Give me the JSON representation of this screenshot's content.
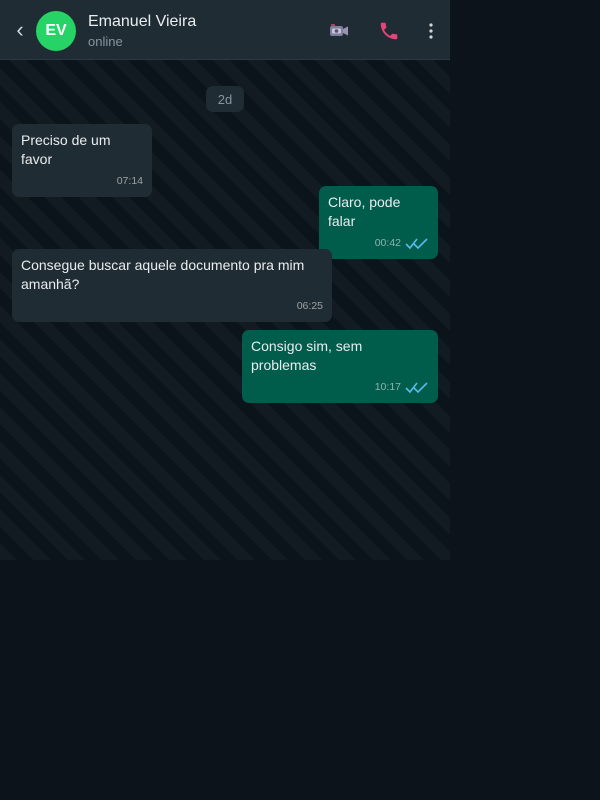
{
  "header": {
    "back_symbol": "‹",
    "avatar_initials": "EV",
    "contact_name": "Emanuel Vieira",
    "status": "online",
    "icons": [
      "video-camera-icon",
      "phone-call-icon",
      "more-vertical-icon"
    ]
  },
  "chat": {
    "date_label": "2d",
    "messages": [
      {
        "direction": "incoming",
        "text": "Preciso de um favor",
        "time": "07:14"
      },
      {
        "direction": "outgoing",
        "text": "Claro, pode falar",
        "time": "00:42",
        "status": "read"
      },
      {
        "direction": "incoming",
        "text": "Consegue buscar aquele documento pra mim amanhã?",
        "time": "06:25"
      },
      {
        "direction": "outgoing",
        "text": "Consigo sim, sem problemas",
        "time": "10:17",
        "status": "read"
      }
    ]
  },
  "colors": {
    "header_bg": "#1f2c34",
    "chat_bg": "#0b141a",
    "incoming_bubble": "#202c33",
    "outgoing_bubble": "#005c4b",
    "avatar_bg": "#25d366",
    "call_icon": "#e8437a",
    "read_ticks": "#53bdeb",
    "page_bg": "#0c131a"
  }
}
